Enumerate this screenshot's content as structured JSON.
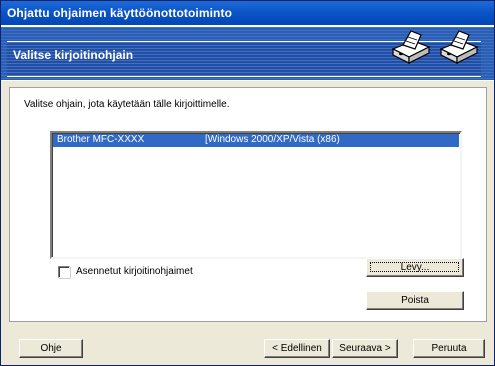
{
  "window": {
    "title": "Ohjattu ohjaimen käyttöönottotoiminto"
  },
  "header": {
    "title": "Valitse kirjoitinohjain",
    "icons": [
      "printer-icon",
      "printer-icon"
    ]
  },
  "content": {
    "instruction": "Valitse ohjain, jota käytetään tälle kirjoittimelle."
  },
  "driver_list": {
    "rows": [
      {
        "manufacturer_model": "Brother   MFC-XXXX",
        "platform": "[Windows 2000/XP/Vista (x86)"
      }
    ],
    "selected_index": 0
  },
  "installed_drivers_checkbox": {
    "label": "Asennetut kirjoitinohjaimet",
    "checked": false
  },
  "buttons": {
    "disk": "Levy...",
    "remove": "Poista",
    "help": "Ohje",
    "back": "< Edellinen",
    "next": "Seuraava >",
    "cancel": "Peruuta"
  },
  "colors": {
    "title_bar": "#0b55c8",
    "header": "#2a5fb8",
    "selection": "#316ac5",
    "dialog_face": "#ece9d8"
  }
}
